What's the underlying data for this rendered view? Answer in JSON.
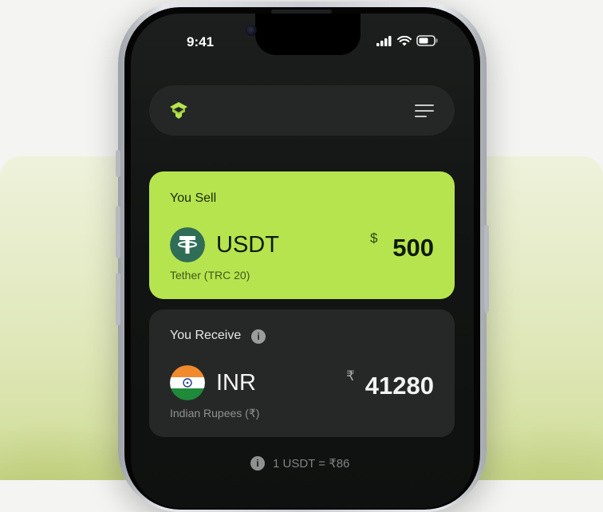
{
  "status_bar": {
    "time": "9:41"
  },
  "header": {
    "logo_icon": "tether-green-logo-icon",
    "menu_icon": "menu-lines-icon"
  },
  "sell_card": {
    "title": "You Sell",
    "currency_code": "USDT",
    "currency_name": "Tether (TRC 20)",
    "symbol": "$",
    "amount": "500",
    "coin_icon": "tether-coin-icon",
    "accent_color": "#b6e44f"
  },
  "receive_card": {
    "title": "You Receive",
    "info_icon": "info-icon",
    "currency_code": "INR",
    "currency_name": "Indian Rupees (₹)",
    "symbol": "₹",
    "amount": "41280",
    "flag_icon": "india-flag-icon"
  },
  "rate": {
    "text": "1 USDT = ₹86",
    "icon": "info-icon"
  }
}
